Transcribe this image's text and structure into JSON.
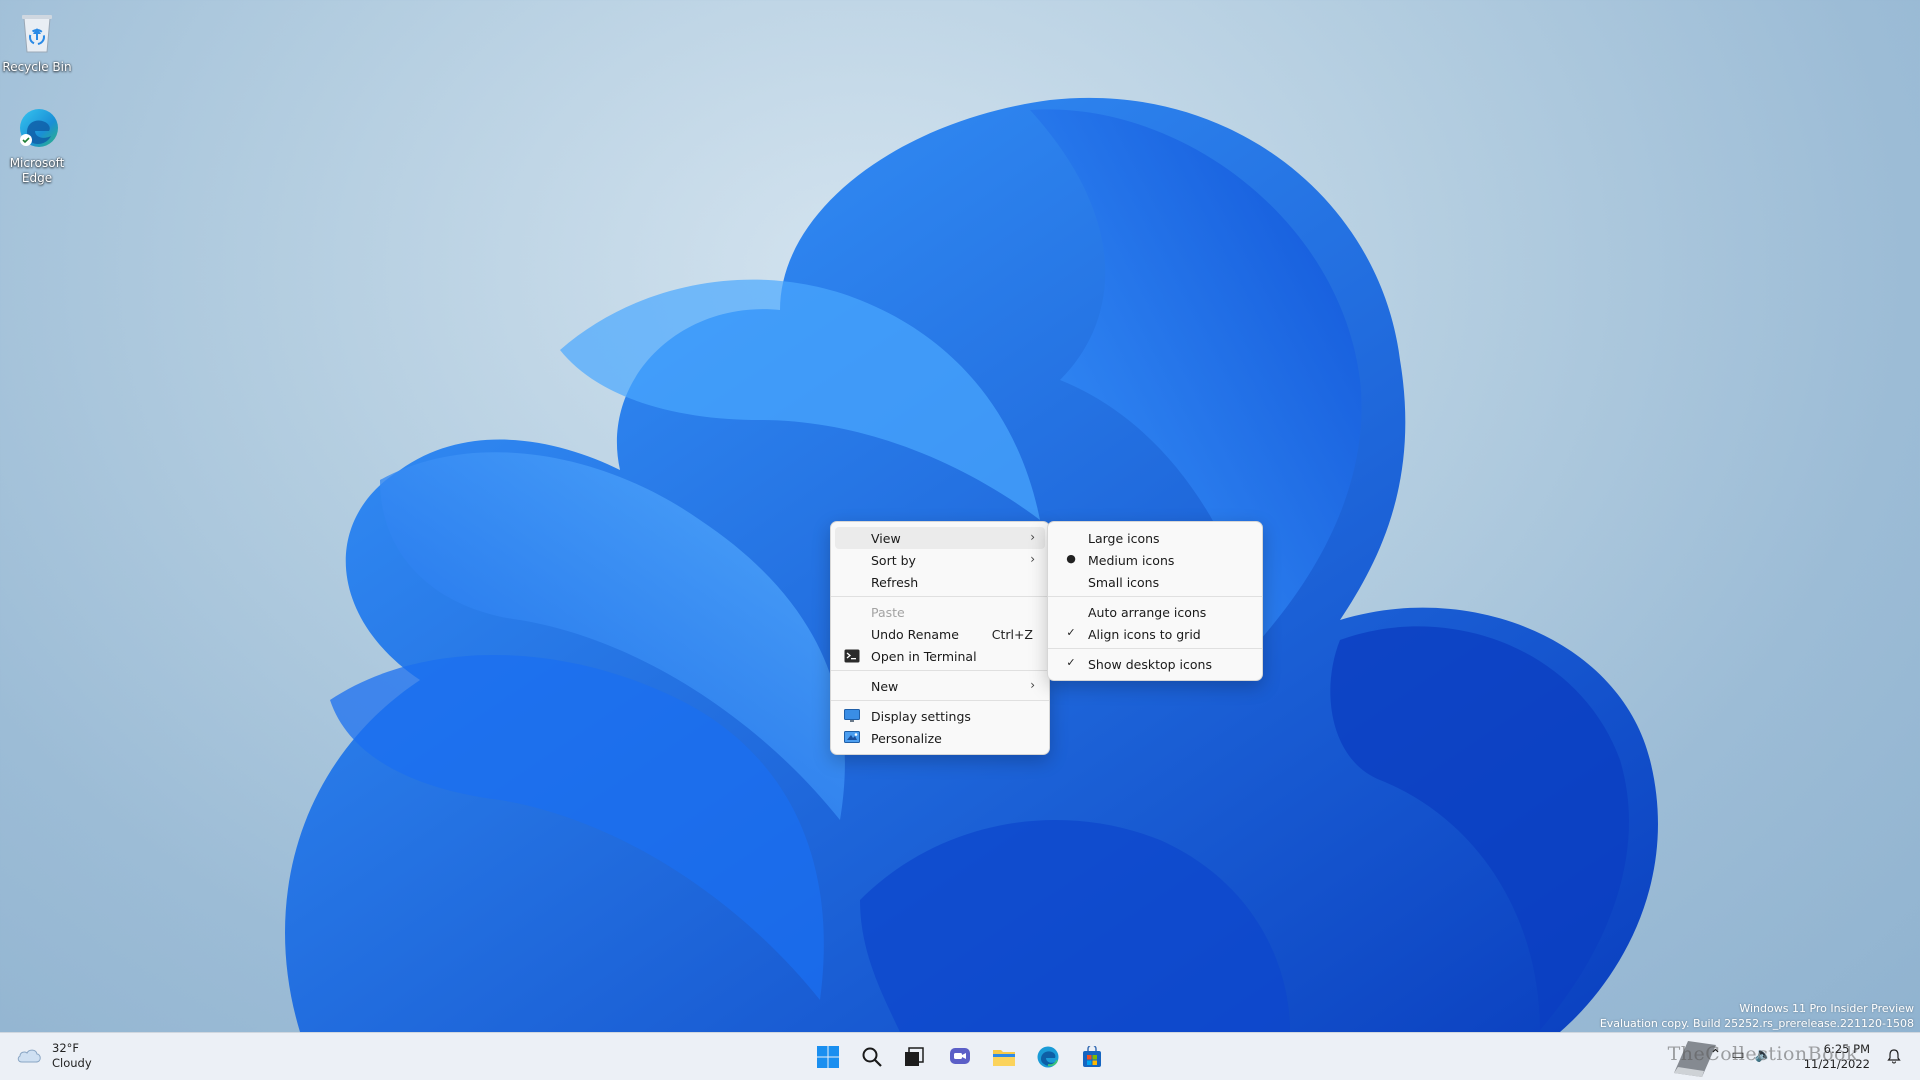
{
  "desktop": {
    "icons": [
      {
        "label": "Recycle Bin"
      },
      {
        "label": "Microsoft Edge"
      }
    ]
  },
  "context_menu": {
    "items": [
      {
        "label": "View",
        "has_submenu": true
      },
      {
        "label": "Sort by",
        "has_submenu": true
      },
      {
        "label": "Refresh"
      },
      {
        "label": "Paste",
        "disabled": true
      },
      {
        "label": "Undo Rename",
        "shortcut": "Ctrl+Z"
      },
      {
        "label": "Open in Terminal",
        "icon": "terminal-icon"
      },
      {
        "label": "New",
        "has_submenu": true
      },
      {
        "label": "Display settings",
        "icon": "display-icon"
      },
      {
        "label": "Personalize",
        "icon": "personalize-icon"
      }
    ]
  },
  "view_submenu": {
    "items": [
      {
        "label": "Large icons"
      },
      {
        "label": "Medium icons",
        "mark": "bullet"
      },
      {
        "label": "Small icons"
      },
      {
        "label": "Auto arrange icons"
      },
      {
        "label": "Align icons to grid",
        "mark": "check"
      },
      {
        "label": "Show desktop icons",
        "mark": "check"
      }
    ]
  },
  "watermark": {
    "line1": "Windows 11 Pro Insider Preview",
    "line2": "Evaluation copy. Build 25252.rs_prerelease.221120-1508"
  },
  "taskbar": {
    "weather": {
      "temp": "32°F",
      "condition": "Cloudy"
    },
    "apps": [
      "start-icon",
      "search-icon",
      "task-view-icon",
      "chat-icon",
      "file-explorer-icon",
      "edge-icon",
      "store-icon"
    ],
    "clock": {
      "time": "6:25 PM",
      "date": "11/21/2022"
    },
    "brand": "TheCollectionBook"
  },
  "colors": {
    "wallpaper_bg": "#a9c6dc",
    "bloom_dark": "#0a3ec0",
    "bloom_light": "#2f8cf5",
    "menu_bg": "#f9f9f9",
    "menu_hover": "#ebebeb"
  }
}
